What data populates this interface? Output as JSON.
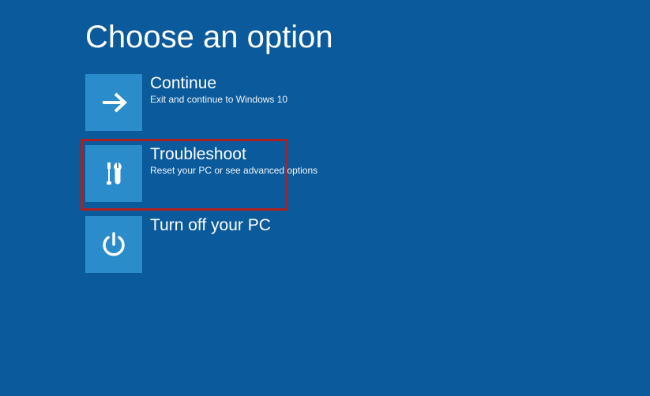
{
  "page": {
    "title": "Choose an option"
  },
  "options": {
    "continue": {
      "title": "Continue",
      "subtitle": "Exit and continue to Windows 10"
    },
    "troubleshoot": {
      "title": "Troubleshoot",
      "subtitle": "Reset your PC or see advanced options"
    },
    "turnoff": {
      "title": "Turn off your PC"
    }
  },
  "highlight": {
    "target": "troubleshoot",
    "color": "#b02020"
  },
  "colors": {
    "background": "#0a5a9c",
    "tile": "#2a8cca"
  }
}
